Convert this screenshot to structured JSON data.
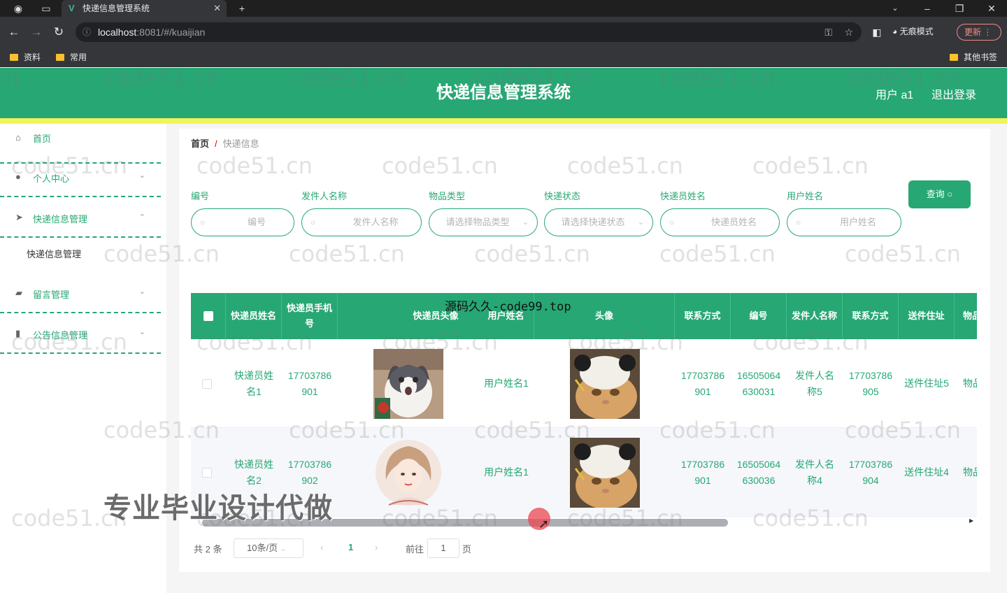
{
  "browser": {
    "tab_title": "快递信息管理系统",
    "url_host": "localhost",
    "url_rest": ":8081/#/kuaijian",
    "incognito_label": "无痕模式",
    "update_label": "更新",
    "bookmarks": [
      "资料",
      "常用"
    ],
    "other_bookmarks": "其他书签"
  },
  "header": {
    "title": "快递信息管理系统",
    "user": "用户 a1",
    "logout": "退出登录"
  },
  "sidebar": {
    "items": [
      {
        "label": "首页"
      },
      {
        "label": "个人中心"
      },
      {
        "label": "快递信息管理"
      },
      {
        "label": "留言管理"
      },
      {
        "label": "公告信息管理"
      }
    ],
    "submenu_active": "快递信息管理"
  },
  "breadcrumb": {
    "home": "首页",
    "separator": "/",
    "current": "快递信息"
  },
  "filters": [
    {
      "label": "编号",
      "placeholder": "编号"
    },
    {
      "label": "发件人名称",
      "placeholder": "发件人名称"
    },
    {
      "label": "物品类型",
      "placeholder": "请选择物品类型"
    },
    {
      "label": "快递状态",
      "placeholder": "请选择快递状态"
    },
    {
      "label": "快递员姓名",
      "placeholder": "快递员姓名"
    },
    {
      "label": "用户姓名",
      "placeholder": "用户姓名"
    }
  ],
  "query_button": "查询",
  "table": {
    "columns": [
      "快递员姓名",
      "快递员手机号",
      "快递员头像",
      "用户姓名",
      "头像",
      "联系方式",
      "编号",
      "发件人名称",
      "联系方式",
      "送件住址",
      "物品"
    ],
    "rows": [
      {
        "courier_name": "快递员姓名1",
        "courier_phone": "17703786901",
        "user_name": "用户姓名1",
        "contact": "17703786901",
        "id": "16505064630031",
        "sender": "发件人名称5",
        "sender_contact": "17703786905",
        "address": "送件住址5",
        "item": "物品"
      },
      {
        "courier_name": "快递员姓名2",
        "courier_phone": "17703786902",
        "user_name": "用户姓名1",
        "contact": "17703786901",
        "id": "16505064630036",
        "sender": "发件人名称4",
        "sender_contact": "17703786904",
        "address": "送件住址4",
        "item": "物品"
      }
    ]
  },
  "pagination": {
    "total": "共 2 条",
    "page_size": "10条/页",
    "current_page": "1",
    "goto_label": "前往",
    "goto_value": "1",
    "unit": "页"
  },
  "overlays": {
    "banner": "源码久久-code99.top",
    "promo": "专业毕业设计代做",
    "watermark": "code51.cn"
  }
}
